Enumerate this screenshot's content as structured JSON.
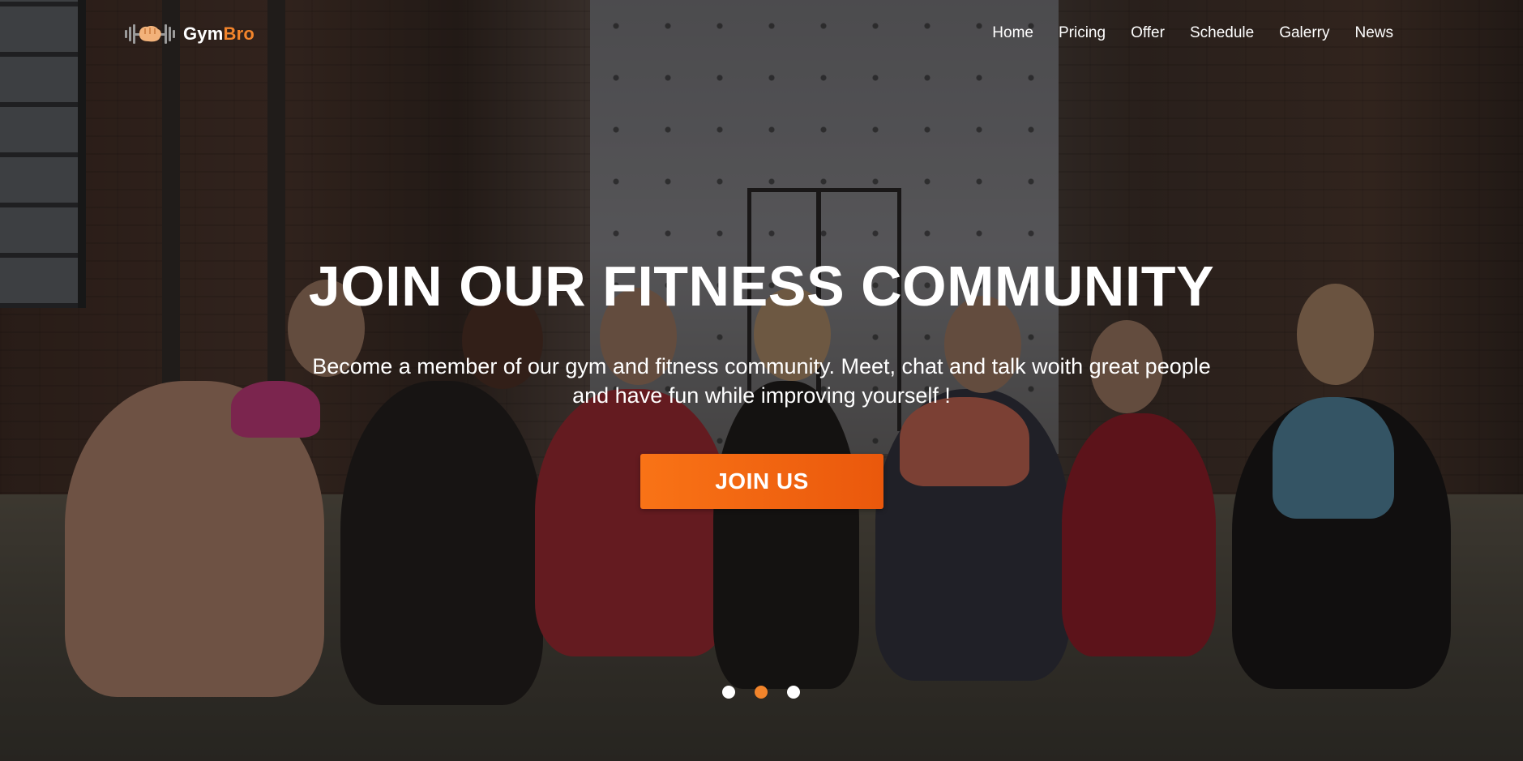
{
  "brand": {
    "name_part1": "Gym",
    "name_part2": "Bro",
    "accent_color": "#f2842b",
    "logo_icon": "dumbbell-fist-icon"
  },
  "nav": {
    "items": [
      {
        "label": "Home"
      },
      {
        "label": "Pricing"
      },
      {
        "label": "Offer"
      },
      {
        "label": "Schedule"
      },
      {
        "label": "Galerry"
      },
      {
        "label": "News"
      }
    ]
  },
  "hero": {
    "title": "JOIN OUR FITNESS COMMUNITY",
    "subtitle": "Become a member of our gym and fitness community. Meet, chat and talk woith great people and have fun while improving yourself !",
    "cta_label": "JOIN US",
    "cta_color": "#f97316",
    "background": "group-of-women-sitting-in-gym-photo"
  },
  "carousel": {
    "slide_count": 3,
    "active_index": 1
  }
}
